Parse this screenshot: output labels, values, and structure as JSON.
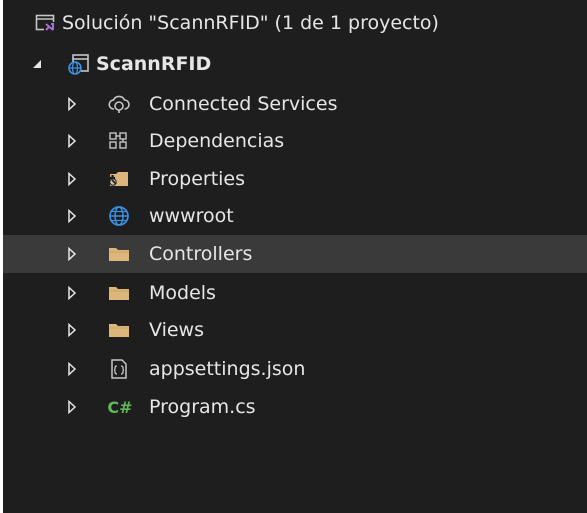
{
  "solution": {
    "label": "Solución \"ScannRFID\"  (1 de 1 proyecto)"
  },
  "project": {
    "label": "ScannRFID"
  },
  "items": [
    {
      "label": "Connected Services",
      "icon": "connected-services-icon"
    },
    {
      "label": "Dependencias",
      "icon": "dependencies-icon"
    },
    {
      "label": "Properties",
      "icon": "properties-icon"
    },
    {
      "label": "wwwroot",
      "icon": "globe-icon"
    },
    {
      "label": "Controllers",
      "icon": "folder-icon"
    },
    {
      "label": "Models",
      "icon": "folder-icon"
    },
    {
      "label": "Views",
      "icon": "folder-icon"
    },
    {
      "label": "appsettings.json",
      "icon": "json-file-icon"
    },
    {
      "label": "Program.cs",
      "icon": "csharp-file-icon"
    }
  ],
  "csharp_icon_text": "C#",
  "colors": {
    "background": "#1e1e1e",
    "selected_row": "#3a3a3a",
    "text": "#e6e6e6",
    "folder": "#dcb67a",
    "globe": "#3c8fe0",
    "csharp": "#5fb955",
    "solution_accent": "#a56fd6"
  }
}
